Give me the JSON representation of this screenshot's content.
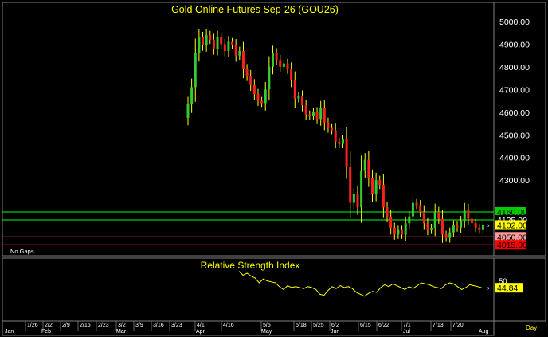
{
  "chart_data": [
    {
      "type": "candlestick",
      "title": "Gold Online Futures Sep-26 (GOU26)",
      "note": "No Gaps",
      "ylim": [
        4000,
        5050
      ],
      "y_ticks": [
        "5000.00",
        "4900.00",
        "4800.00",
        "4700.00",
        "4600.00",
        "4500.00",
        "4400.00",
        "4300.00"
      ],
      "grid": false,
      "candle_colors": {
        "up": "#32cd32",
        "down": "#ff2020",
        "wick": "#ffff00"
      },
      "horizontal_lines": [
        {
          "value": 4160,
          "label": "4160.00",
          "color": "#00ff00",
          "label_bg": "#00cc00",
          "label_fg": "#000000"
        },
        {
          "value": 4125,
          "label": "4125.00",
          "color": "#00ff00",
          "label_bg": "#000000",
          "label_fg": "#ffffff"
        },
        {
          "value": 4050,
          "label": "4050.00",
          "color": "#ff4040",
          "label_bg": "#ff9999",
          "label_fg": "#000000"
        },
        {
          "value": 4015,
          "label": "4015.00",
          "color": "#ff2020",
          "label_bg": "#ff0000",
          "label_fg": "#000000"
        }
      ],
      "last_price": {
        "value": 4102,
        "label": "4102.00",
        "label_bg": "#ffff00",
        "label_fg": "#000000"
      },
      "close": [
        4635,
        4710,
        4860,
        4930,
        4895,
        4940,
        4920,
        4880,
        4930,
        4900,
        4870,
        4910,
        4895,
        4850,
        4870,
        4790,
        4760,
        4720,
        4680,
        4650,
        4640,
        4700,
        4800,
        4860,
        4830,
        4800,
        4815,
        4790,
        4740,
        4660,
        4670,
        4630,
        4590,
        4585,
        4600,
        4570,
        4620,
        4555,
        4530,
        4520,
        4470,
        4460,
        4480,
        4360,
        4200,
        4240,
        4180,
        4340,
        4390,
        4310,
        4240,
        4300,
        4280,
        4180,
        4140,
        4090,
        4060,
        4080,
        4060,
        4110,
        4140,
        4200,
        4190,
        4160,
        4110,
        4080,
        4090,
        4160,
        4130,
        4060,
        4045,
        4070,
        4100,
        4090,
        4120,
        4170,
        4130,
        4110,
        4090,
        4080,
        4102
      ]
    },
    {
      "type": "line",
      "title": "Relative Strength Index",
      "y_ticks": [
        "50"
      ],
      "last_value": "44.84",
      "line_color": "#ffff00",
      "values": [
        62,
        58,
        60,
        57,
        55,
        50,
        54,
        52,
        51,
        50,
        46,
        43,
        47,
        45,
        46,
        45,
        44,
        46,
        45,
        43,
        38,
        37,
        42,
        46,
        44,
        47,
        45,
        46,
        44,
        40,
        38,
        36,
        39,
        41,
        40,
        45,
        48,
        46,
        49,
        47,
        45,
        43,
        46,
        44,
        47,
        50,
        49,
        48,
        46,
        45,
        44,
        48,
        50,
        49,
        46,
        43,
        45,
        48,
        47,
        46,
        44.84
      ]
    }
  ],
  "x_axis": {
    "month_labels": [
      "Jan",
      "Feb",
      "Mar",
      "Apr",
      "May",
      "Jun",
      "Jul",
      "Aug"
    ],
    "day_labels": [
      "1/26",
      "2/2",
      "2/9",
      "2/16",
      "2/23",
      "3/2",
      "3/9",
      "3/16",
      "3/23",
      "4/1",
      "4/16",
      "5/5",
      "5/18",
      "5/25",
      "6/2",
      "6/15",
      "6/22",
      "7/1",
      "7/13",
      "7/20"
    ],
    "period": "Day"
  }
}
